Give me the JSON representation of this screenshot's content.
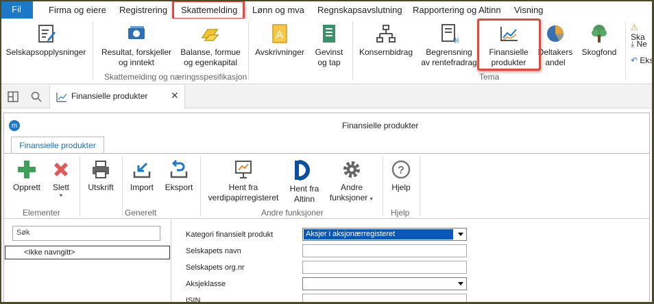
{
  "menubar": {
    "fil": "Fil",
    "tabs": [
      "Firma og eiere",
      "Registrering",
      "Skattemelding",
      "Lønn og mva",
      "Regnskapsavslutning",
      "Rapportering og Altinn",
      "Visning"
    ]
  },
  "ribbon": {
    "buttons": {
      "selskapsopplysninger": "Selskapsopplysninger",
      "resultat_1": "Resultat, forskjeller",
      "resultat_2": "og inntekt",
      "balanse_1": "Balanse, formue",
      "balanse_2": "og egenkapital",
      "avskrivninger": "Avskrivninger",
      "gevinst_1": "Gevinst",
      "gevinst_2": "og tap",
      "konsernbidrag": "Konsernbidrag",
      "begrensning_1": "Begrensning",
      "begrensning_2": "av rentefradrag",
      "finansielle_1": "Finansielle",
      "finansielle_2": "produkter",
      "deltakers_1": "Deltakers",
      "deltakers_2": "andel",
      "skogfond": "Skogfond"
    },
    "groups": {
      "skattemelding": "Skattemelding og næringsspesifikasjon",
      "tema": "Tema"
    },
    "side": [
      "Ska",
      "Ne",
      "Eks"
    ]
  },
  "tabstrip": {
    "doc_tab": "Finansielle produkter"
  },
  "inner": {
    "title": "Finansielle produkter",
    "tab": "Finansielle produkter",
    "buttons": {
      "opprett": "Opprett",
      "slett": "Slett",
      "utskrift": "Utskrift",
      "import": "Import",
      "eksport": "Eksport",
      "hent_vp_1": "Hent fra",
      "hent_vp_2": "verdipapirregisteret",
      "hent_alt_1": "Hent fra",
      "hent_alt_2": "Altinn",
      "andre_1": "Andre",
      "andre_2": "funksjoner",
      "hjelp": "Hjelp"
    },
    "groups": {
      "elementer": "Elementer",
      "generelt": "Generelt",
      "andre": "Andre funksjoner",
      "hjelp": "Hjelp"
    }
  },
  "sidebar": {
    "search_placeholder": "Søk",
    "item": "<Ikke navngitt>"
  },
  "form": {
    "labels": {
      "kategori": "Kategori finansielt produkt",
      "navn": "Selskapets navn",
      "orgnr": "Selskapets org.nr",
      "aksjeklasse": "Aksjeklasse",
      "isin": "ISIN"
    },
    "kategori_value": "Aksjer i aksjonærregisteret",
    "isin_value": "____________"
  },
  "colors": {
    "accent": "#1e78c8",
    "highlight": "#e04a3c",
    "selected": "#0a58b8"
  }
}
